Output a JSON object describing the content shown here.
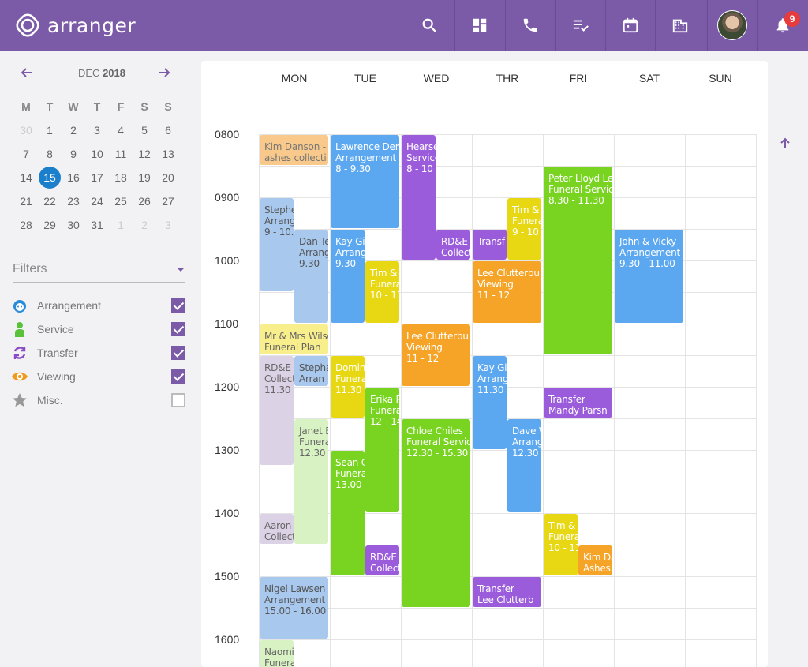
{
  "app": {
    "name": "arranger",
    "notification_count": "9"
  },
  "colors": {
    "brand": "#7b5ba8",
    "today": "#1b7fcc",
    "badge": "#e83b3b"
  },
  "nav_icons": [
    "search-icon",
    "dashboard-icon",
    "phone-icon",
    "checklist-icon",
    "calendar-icon",
    "building-icon",
    "avatar",
    "bell-icon"
  ],
  "minical": {
    "month": "DEC",
    "year": "2018",
    "dow": [
      "M",
      "T",
      "W",
      "T",
      "F",
      "S",
      "S"
    ],
    "weeks": [
      [
        "30",
        "1",
        "2",
        "3",
        "4",
        "5",
        "6"
      ],
      [
        "7",
        "8",
        "9",
        "10",
        "11",
        "12",
        "13"
      ],
      [
        "14",
        "15",
        "16",
        "17",
        "18",
        "19",
        "20"
      ],
      [
        "21",
        "22",
        "23",
        "24",
        "25",
        "26",
        "27"
      ],
      [
        "28",
        "29",
        "30",
        "31",
        "1",
        "2",
        "3"
      ]
    ],
    "today": "15"
  },
  "filters": {
    "title": "Filters",
    "items": [
      {
        "label": "Arrangement",
        "icon": "face-icon",
        "color": "#2a8bd8",
        "checked": true
      },
      {
        "label": "Service",
        "icon": "person-icon",
        "color": "#5ac23a",
        "checked": true
      },
      {
        "label": "Transfer",
        "icon": "transfer-icon",
        "color": "#8a4bc4",
        "checked": true
      },
      {
        "label": "Viewing",
        "icon": "eye-icon",
        "color": "#f09a20",
        "checked": true
      },
      {
        "label": "Misc.",
        "icon": "star-icon",
        "color": "#999999",
        "checked": false
      }
    ]
  },
  "week": {
    "days": [
      "MON",
      "TUE",
      "WED",
      "THR",
      "FRI",
      "SAT",
      "SUN"
    ],
    "hours": [
      "0800",
      "0900",
      "1000",
      "1100",
      "1200",
      "1300",
      "1400",
      "1500",
      "1600"
    ]
  },
  "events": [
    {
      "day": 0,
      "start": 8.0,
      "end": 8.5,
      "col": 0,
      "cols": 1,
      "color": "#f8c98a",
      "text": "#777",
      "lines": [
        "Kim Danson -",
        "ashes collecti"
      ]
    },
    {
      "day": 0,
      "start": 9.0,
      "end": 10.5,
      "col": 0,
      "cols": 2,
      "color": "#a8c8ee",
      "text": "#555",
      "lines": [
        "Stephe",
        "Arrang",
        "9 - 10.3"
      ]
    },
    {
      "day": 0,
      "start": 9.5,
      "end": 11.0,
      "col": 1,
      "cols": 2,
      "color": "#a8c8ee",
      "text": "#555",
      "lines": [
        "Dan Tel",
        "Arrang",
        "9.30 - 1"
      ]
    },
    {
      "day": 0,
      "start": 11.0,
      "end": 11.5,
      "col": 0,
      "cols": 1,
      "color": "#f9ee8c",
      "text": "#666",
      "lines": [
        "Mr & Mrs Wilso",
        "Funeral Plan"
      ]
    },
    {
      "day": 0,
      "start": 11.5,
      "end": 13.25,
      "col": 0,
      "cols": 2,
      "color": "#dcd2e6",
      "text": "#666",
      "lines": [
        "RD&E",
        "Collect",
        "11.30 -"
      ]
    },
    {
      "day": 0,
      "start": 11.5,
      "end": 12.0,
      "col": 1,
      "cols": 2,
      "color": "#a8c8ee",
      "text": "#555",
      "lines": [
        "Stepha",
        "Arran"
      ]
    },
    {
      "day": 0,
      "start": 12.5,
      "end": 14.5,
      "col": 1,
      "cols": 2,
      "color": "#d8f2c4",
      "text": "#666",
      "lines": [
        "Janet B",
        "Funera",
        "12.30 -"
      ]
    },
    {
      "day": 0,
      "start": 14.0,
      "end": 14.5,
      "col": 0,
      "cols": 2,
      "color": "#dcd2e6",
      "text": "#666",
      "lines": [
        "Aaron",
        "Collect"
      ]
    },
    {
      "day": 0,
      "start": 15.0,
      "end": 16.0,
      "col": 0,
      "cols": 1,
      "color": "#a8c8ee",
      "text": "#555",
      "lines": [
        "Nigel Lawsen",
        "Arrangement",
        "15.00 - 16.00"
      ]
    },
    {
      "day": 0,
      "start": 16.0,
      "end": 16.5,
      "col": 0,
      "cols": 2,
      "color": "#d8f2c4",
      "text": "#666",
      "lines": [
        "Naomi",
        "Funera"
      ]
    },
    {
      "day": 1,
      "start": 8.0,
      "end": 9.5,
      "col": 0,
      "cols": 1,
      "color": "#5ca8f0",
      "text": "#fff",
      "lines": [
        "Lawrence Dem",
        "Arrangement",
        "8 - 9.30"
      ]
    },
    {
      "day": 1,
      "start": 9.5,
      "end": 11.0,
      "col": 0,
      "cols": 2,
      "color": "#5ca8f0",
      "text": "#fff",
      "lines": [
        "Kay Gi",
        "Arrang",
        "9.30 - 1"
      ]
    },
    {
      "day": 1,
      "start": 10.0,
      "end": 11.0,
      "col": 1,
      "cols": 2,
      "color": "#e8d813",
      "text": "#fff",
      "lines": [
        "Tim &",
        "Funera",
        "10 - 11"
      ]
    },
    {
      "day": 1,
      "start": 11.5,
      "end": 12.5,
      "col": 0,
      "cols": 2,
      "color": "#e8d813",
      "text": "#fff",
      "lines": [
        "Domini",
        "Funera",
        "11.30 -"
      ]
    },
    {
      "day": 1,
      "start": 12.0,
      "end": 14.0,
      "col": 1,
      "cols": 2,
      "color": "#78d420",
      "text": "#fff",
      "lines": [
        "Erika P",
        "Funera",
        "12 - 14"
      ]
    },
    {
      "day": 1,
      "start": 13.0,
      "end": 15.0,
      "col": 0,
      "cols": 2,
      "color": "#78d420",
      "text": "#fff",
      "lines": [
        "Sean C",
        "Funera",
        "13.00 -"
      ]
    },
    {
      "day": 1,
      "start": 14.5,
      "end": 15.0,
      "col": 1,
      "cols": 2,
      "color": "#9b5cdc",
      "text": "#fff",
      "lines": [
        "RD&E",
        "Collect"
      ]
    },
    {
      "day": 2,
      "start": 8.0,
      "end": 10.0,
      "col": 0,
      "cols": 2,
      "color": "#9b5cdc",
      "text": "#fff",
      "lines": [
        "Hearse",
        "Service",
        "8 - 10"
      ]
    },
    {
      "day": 2,
      "start": 9.5,
      "end": 10.0,
      "col": 1,
      "cols": 2,
      "color": "#9b5cdc",
      "text": "#fff",
      "lines": [
        "RD&E",
        "Collect"
      ]
    },
    {
      "day": 2,
      "start": 11.0,
      "end": 12.0,
      "col": 0,
      "cols": 1,
      "color": "#f5a428",
      "text": "#fff",
      "lines": [
        "Lee Clutterbu",
        "Viewing",
        "11 - 12"
      ]
    },
    {
      "day": 2,
      "start": 12.5,
      "end": 15.5,
      "col": 0,
      "cols": 1,
      "color": "#78d420",
      "text": "#fff",
      "lines": [
        "Chloe Chiles",
        "Funeral Servic",
        "12.30 - 15.30"
      ]
    },
    {
      "day": 3,
      "start": 9.0,
      "end": 10.0,
      "col": 1,
      "cols": 2,
      "color": "#e8d813",
      "text": "#fff",
      "lines": [
        "Tim &",
        "Funera",
        "9 - 10"
      ]
    },
    {
      "day": 3,
      "start": 9.5,
      "end": 10.0,
      "col": 0,
      "cols": 2,
      "color": "#9b5cdc",
      "text": "#fff",
      "lines": [
        "Transf"
      ]
    },
    {
      "day": 3,
      "start": 10.0,
      "end": 11.0,
      "col": 0,
      "cols": 1,
      "color": "#f5a428",
      "text": "#fff",
      "lines": [
        "Lee Clutterbu",
        "Viewing",
        "11 - 12"
      ]
    },
    {
      "day": 3,
      "start": 11.5,
      "end": 13.0,
      "col": 0,
      "cols": 2,
      "color": "#5ca8f0",
      "text": "#fff",
      "lines": [
        "Kay Gi",
        "Arrang",
        "11.30 -"
      ]
    },
    {
      "day": 3,
      "start": 12.5,
      "end": 14.0,
      "col": 1,
      "cols": 2,
      "color": "#5ca8f0",
      "text": "#fff",
      "lines": [
        "Dave W",
        "Arrang",
        "12.30 -"
      ]
    },
    {
      "day": 3,
      "start": 15.0,
      "end": 15.5,
      "col": 0,
      "cols": 1,
      "color": "#9b5cdc",
      "text": "#fff",
      "lines": [
        "Transfer",
        "Lee Clutterb"
      ]
    },
    {
      "day": 4,
      "start": 8.5,
      "end": 11.5,
      "col": 0,
      "cols": 1,
      "color": "#78d420",
      "text": "#fff",
      "lines": [
        "Peter Lloyd Le",
        "Funeral Servic",
        "8.30 - 11.30"
      ]
    },
    {
      "day": 4,
      "start": 12.0,
      "end": 12.5,
      "col": 0,
      "cols": 1,
      "color": "#9b5cdc",
      "text": "#fff",
      "lines": [
        "Transfer",
        "Mandy Parsn"
      ]
    },
    {
      "day": 4,
      "start": 14.0,
      "end": 15.0,
      "col": 0,
      "cols": 2,
      "color": "#e8d813",
      "text": "#fff",
      "lines": [
        "Tim &",
        "Funera",
        "10 - 11"
      ]
    },
    {
      "day": 4,
      "start": 14.5,
      "end": 15.0,
      "col": 1,
      "cols": 2,
      "color": "#f5a428",
      "text": "#fff",
      "lines": [
        "Kim Da",
        "Ashes c"
      ]
    },
    {
      "day": 5,
      "start": 9.5,
      "end": 11.0,
      "col": 0,
      "cols": 1,
      "color": "#5ca8f0",
      "text": "#fff",
      "lines": [
        "John & Vicky",
        "Arrangement",
        "9.30 - 11.00"
      ]
    }
  ]
}
